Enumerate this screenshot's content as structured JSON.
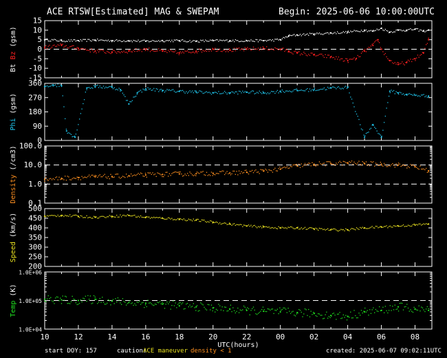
{
  "header": {
    "title": "ACE RTSW[Estimated] MAG & SWEPAM",
    "begin": "Begin: 2025-06-06 10:00:00UTC"
  },
  "footer": {
    "start_doy": "start DOY: 157",
    "caution_label": "caution:",
    "caution_maneuver": "ACE maneuver",
    "caution_density": "density < 1",
    "created": "created: 2025-06-07 09:02:11UTC"
  },
  "colors": {
    "bt": "#ffffff",
    "bz": "#ff2020",
    "phi": "#20c8f0",
    "density": "#ff9020",
    "speed": "#e8e020",
    "temp": "#20e020",
    "maneuver": "#e8e020",
    "density_low": "#ff9020"
  },
  "chart_data": [
    {
      "type": "line",
      "panel": "mag",
      "ylabel_parts": [
        "Bt",
        "Bz",
        "(gsm)"
      ],
      "yticks": [
        15,
        10,
        5,
        0,
        -5,
        -10,
        -15
      ],
      "ylim": [
        -15,
        15
      ],
      "reference_lines": [
        0
      ],
      "x_range_hours": [
        0,
        23
      ],
      "series": [
        {
          "name": "Bt",
          "x": [
            0,
            1,
            2,
            3,
            4,
            5,
            6,
            7,
            8,
            9,
            10,
            11,
            12,
            13,
            14,
            14.5,
            15,
            16,
            17,
            18,
            19,
            19.5,
            20,
            20.5,
            21,
            21.5,
            22,
            22.5,
            22.8
          ],
          "y": [
            5,
            4.5,
            4.5,
            4.8,
            4.5,
            4.5,
            4.2,
            4.5,
            4.5,
            4.2,
            4.5,
            4.5,
            4.5,
            4.5,
            5,
            7,
            7.5,
            8,
            8.5,
            9,
            10,
            9.5,
            11,
            9,
            10,
            10,
            10.5,
            9.5,
            10
          ]
        },
        {
          "name": "Bz",
          "x": [
            0,
            1,
            2,
            3,
            4,
            5,
            6,
            7,
            8,
            9,
            10,
            11,
            12,
            13,
            14,
            14.5,
            15,
            16,
            17,
            18,
            18.5,
            19,
            19.5,
            19.8,
            20,
            20.5,
            21,
            21.5,
            22,
            22.5,
            22.8
          ],
          "y": [
            1,
            2,
            0.5,
            -1,
            -1.5,
            -1,
            0,
            -1,
            -2,
            -1,
            0,
            -0.5,
            0,
            0.5,
            0,
            -1,
            -2,
            -3,
            -4,
            -6,
            -5,
            -1,
            2,
            5,
            0,
            -6,
            -8,
            -7,
            -5,
            -2,
            5
          ]
        }
      ]
    },
    {
      "type": "scatter",
      "panel": "phi",
      "ylabel_parts": [
        "Phi",
        "(gsm)"
      ],
      "yticks": [
        360,
        270,
        180,
        90,
        0
      ],
      "ylim": [
        0,
        360
      ],
      "x_range_hours": [
        0,
        23
      ],
      "series": [
        {
          "name": "Phi",
          "x": [
            0,
            0.5,
            1,
            1.3,
            1.8,
            2.5,
            3,
            4,
            4.5,
            5,
            5.5,
            6,
            7,
            8,
            9,
            10,
            11,
            12,
            13,
            14,
            15,
            16,
            17,
            18,
            19,
            19.5,
            20,
            20.5,
            21,
            21.5,
            22,
            22.8
          ],
          "y": [
            340,
            350,
            345,
            60,
            20,
            330,
            340,
            335,
            320,
            230,
            300,
            325,
            315,
            310,
            305,
            300,
            300,
            305,
            300,
            310,
            315,
            320,
            330,
            335,
            20,
            100,
            20,
            310,
            300,
            290,
            285,
            280
          ]
        }
      ]
    },
    {
      "type": "scatter",
      "panel": "density",
      "ylabel_parts": [
        "Density",
        "(/cm3)"
      ],
      "yticks": [
        "100.0",
        "10.0",
        "1.0",
        "0.1"
      ],
      "ylim": [
        0.1,
        100
      ],
      "log": true,
      "reference_lines": [
        10,
        1
      ],
      "x_range_hours": [
        0,
        23
      ],
      "series": [
        {
          "name": "Density",
          "x": [
            0,
            1,
            2,
            3,
            4,
            5,
            6,
            7,
            8,
            9,
            10,
            11,
            12,
            13,
            14,
            15,
            16,
            17,
            18,
            19,
            20,
            21,
            22,
            22.8
          ],
          "y": [
            1.8,
            2.0,
            2.2,
            2.4,
            2.5,
            2.7,
            3.0,
            3.2,
            3.4,
            3.5,
            3.7,
            3.8,
            4.2,
            4.8,
            6,
            9,
            11,
            12,
            13,
            12,
            11,
            10,
            8,
            5
          ]
        }
      ]
    },
    {
      "type": "scatter",
      "panel": "speed",
      "ylabel_parts": [
        "Speed",
        "(km/s)"
      ],
      "yticks": [
        500,
        450,
        400,
        350,
        300,
        250,
        200
      ],
      "ylim": [
        200,
        500
      ],
      "x_range_hours": [
        0,
        23
      ],
      "series": [
        {
          "name": "Speed",
          "x": [
            0,
            1,
            2,
            3,
            4,
            5,
            6,
            7,
            8,
            9,
            10,
            11,
            12,
            13,
            14,
            15,
            16,
            17,
            18,
            19,
            20,
            21,
            22,
            22.8
          ],
          "y": [
            460,
            465,
            460,
            455,
            460,
            465,
            455,
            450,
            445,
            440,
            430,
            420,
            410,
            405,
            400,
            400,
            395,
            390,
            390,
            400,
            405,
            410,
            415,
            420
          ]
        }
      ]
    },
    {
      "type": "scatter",
      "panel": "temp",
      "ylabel_parts": [
        "Temp",
        "(K)"
      ],
      "yticks": [
        "1.0E+06",
        "1.0E+05",
        "1.0E+04"
      ],
      "ylim": [
        10000,
        1000000
      ],
      "log": true,
      "reference_lines": [
        100000
      ],
      "x_range_hours": [
        0,
        23
      ],
      "series": [
        {
          "name": "Temp",
          "x": [
            0,
            1,
            2,
            3,
            4,
            5,
            6,
            7,
            8,
            9,
            10,
            11,
            12,
            13,
            14,
            15,
            16,
            17,
            18,
            19,
            20,
            21,
            22,
            22.8
          ],
          "y": [
            110000,
            105000,
            100000,
            110000,
            95000,
            85000,
            80000,
            75000,
            65000,
            60000,
            55000,
            50000,
            45000,
            42000,
            40000,
            38000,
            35000,
            30000,
            28000,
            40000,
            45000,
            60000,
            50000,
            45000
          ]
        }
      ]
    }
  ],
  "x_axis": {
    "ticks": [
      "10",
      "12",
      "14",
      "16",
      "18",
      "20",
      "22",
      "00",
      "02",
      "04",
      "06",
      "08"
    ],
    "label": "UTC(hours)"
  }
}
